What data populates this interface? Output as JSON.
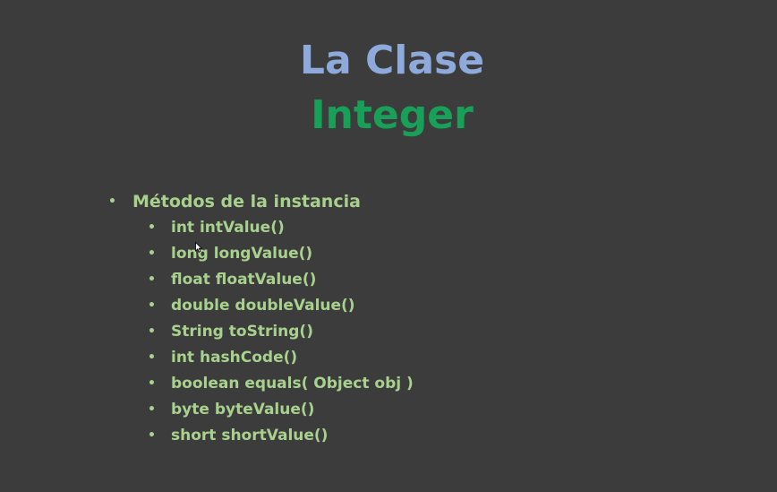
{
  "slide": {
    "title_line1": "La Clase",
    "title_line2": "Integer",
    "bullet_char": "•",
    "main_bullet": "Métodos de la instancia",
    "methods": [
      "int intValue()",
      "long longValue()",
      "float floatValue()",
      "double doubleValue()",
      "String toString()",
      "int hashCode()",
      "boolean equals( Object obj )",
      "byte byteValue()",
      "short shortValue()"
    ]
  },
  "colors": {
    "background": "#3c3c3c",
    "title_line1": "#8eaadb",
    "title_line2": "#18a058",
    "body_text": "#a9d18e"
  }
}
